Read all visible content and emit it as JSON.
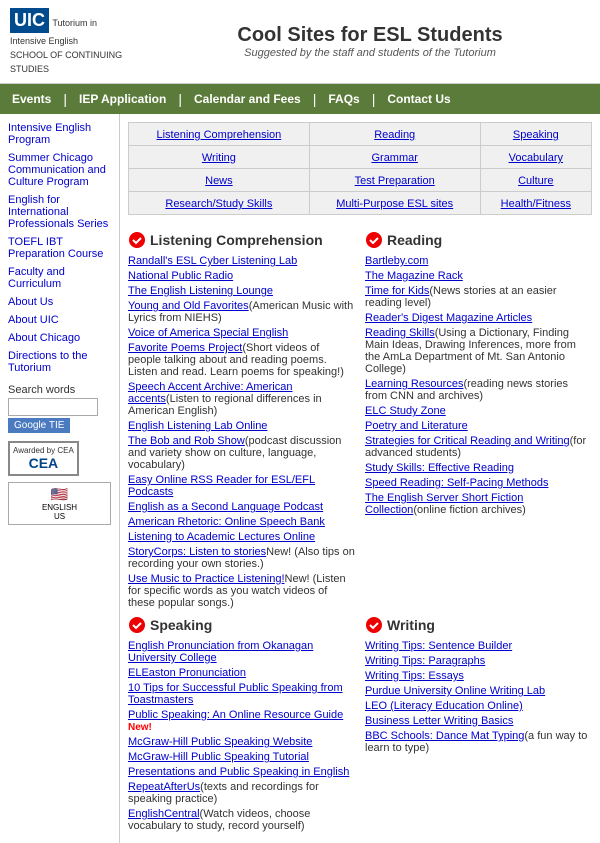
{
  "header": {
    "logo_main": "UIC",
    "logo_sub1": "Tutorium in",
    "logo_sub2": "Intensive English",
    "logo_sub3": "SCHOOL OF CONTINUING STUDIES",
    "title": "Cool Sites for ESL Students",
    "subtitle": "Suggested by the staff and students of the Tutorium"
  },
  "nav": {
    "items": [
      "Events",
      "IEP Application",
      "Calendar and Fees",
      "FAQs",
      "Contact Us"
    ]
  },
  "sidebar": {
    "links": [
      "Intensive English Program",
      "Summer Chicago Communication and Culture Program",
      "English for International Professionals Series",
      "TOEFL IBT Preparation Course",
      "Faculty and Curriculum",
      "About Us",
      "About UIC",
      "About Chicago",
      "Directions to the Tutorium"
    ],
    "search_label": "Search words",
    "search_placeholder": "",
    "google_label": "Google TIE",
    "cea_label": "Awarded by CEA",
    "cea_text": "CEA"
  },
  "nav_table": {
    "rows": [
      [
        "Listening Comprehension",
        "Reading",
        "Speaking"
      ],
      [
        "Writing",
        "Grammar",
        "Vocabulary"
      ],
      [
        "News",
        "Test Preparation",
        "Culture"
      ],
      [
        "Research/Study Skills",
        "Multi-Purpose ESL sites",
        "Health/Fitness"
      ]
    ]
  },
  "listening": {
    "title": "Listening Comprehension",
    "items": [
      {
        "text": "Randall's ESL Cyber Listening Lab",
        "desc": ""
      },
      {
        "text": "National Public Radio",
        "desc": ""
      },
      {
        "text": "The English Listening Lounge",
        "desc": ""
      },
      {
        "text": "Young and Old Favorites",
        "desc": "(American Music with Lyrics from NIEHS)"
      },
      {
        "text": "Voice of America Special English",
        "desc": ""
      },
      {
        "text": "Favorite Poems Project",
        "desc": "(Short videos of people talking about and reading poems. Listen and read. Learn poems for speaking!)"
      },
      {
        "text": "Speech Accent Archive: American accents",
        "desc": "(Listen to regional differences in American English)"
      },
      {
        "text": "English Listening Lab Online",
        "desc": ""
      },
      {
        "text": "The Bob and Rob Show",
        "desc": "(podcast discussion and variety show on culture, language, vocabulary)"
      },
      {
        "text": "Easy Online RSS Reader for ESL/EFL Podcasts",
        "desc": ""
      },
      {
        "text": "English as a Second Language Podcast",
        "desc": ""
      },
      {
        "text": "American Rhetoric: Online Speech Bank",
        "desc": ""
      },
      {
        "text": "Listening to Academic Lectures Online",
        "desc": ""
      },
      {
        "text": "StoryCorps: Listen to stories",
        "desc": "New! (Also tips on recording your own stories.)"
      },
      {
        "text": "Use Music to Practice Listening!",
        "desc": "New! (Listen for specific words as you watch videos of these popular songs.)"
      }
    ]
  },
  "reading": {
    "title": "Reading",
    "items": [
      {
        "text": "Bartleby.com",
        "desc": ""
      },
      {
        "text": "The Magazine Rack",
        "desc": ""
      },
      {
        "text": "Time for Kids",
        "desc": "(News stories at an easier reading level)"
      },
      {
        "text": "Reader's Digest Magazine Articles",
        "desc": ""
      },
      {
        "text": "Reading Skills",
        "desc": "(Using a Dictionary, Finding Main Ideas, Drawing Inferences, more from the AmLa Department of Mt. San Antonio College)"
      },
      {
        "text": "Learning Resources",
        "desc": "(reading news stories from CNN and archives)"
      },
      {
        "text": "ELC Study Zone",
        "desc": ""
      },
      {
        "text": "Poetry and Literature",
        "desc": ""
      },
      {
        "text": "Strategies for Critical Reading and Writing",
        "desc": "(for advanced students)"
      },
      {
        "text": "Study Skills: Effective Reading",
        "desc": ""
      },
      {
        "text": "Speed Reading: Self-Pacing Methods",
        "desc": ""
      },
      {
        "text": "The English Server Short Fiction Collection",
        "desc": "(online fiction archives)"
      }
    ]
  },
  "speaking": {
    "title": "Speaking",
    "items": [
      {
        "text": "English Pronunciation from Okanagan University College",
        "desc": ""
      },
      {
        "text": "ELEaston Pronunciation",
        "desc": ""
      },
      {
        "text": "10 Tips for Successful Public Speaking from Toastmasters",
        "desc": ""
      },
      {
        "text": "Public Speaking: An Online Resource Guide",
        "desc": "New!"
      },
      {
        "text": "McGraw-Hill Public Speaking Website",
        "desc": ""
      },
      {
        "text": "McGraw-Hill Public Speaking Tutorial",
        "desc": ""
      },
      {
        "text": "Presentations and Public Speaking in English",
        "desc": ""
      },
      {
        "text": "RepeatAfterUs",
        "desc": "(texts and recordings for speaking practice)"
      },
      {
        "text": "EnglishCentral",
        "desc": "(Watch videos, choose vocabulary to study, record yourself)"
      }
    ]
  },
  "writing": {
    "title": "Writing",
    "items": [
      {
        "text": "Writing Tips: Sentence Builder",
        "desc": ""
      },
      {
        "text": "Writing Tips: Paragraphs",
        "desc": ""
      },
      {
        "text": "Writing Tips: Essays",
        "desc": ""
      },
      {
        "text": "Purdue University Online Writing Lab",
        "desc": ""
      },
      {
        "text": "LEO (Literacy Education Online)",
        "desc": ""
      },
      {
        "text": "Business Letter Writing Basics",
        "desc": ""
      },
      {
        "text": "BBC Schools: Dance Mat Typing",
        "desc": "(a fun way to learn to type)"
      }
    ]
  }
}
